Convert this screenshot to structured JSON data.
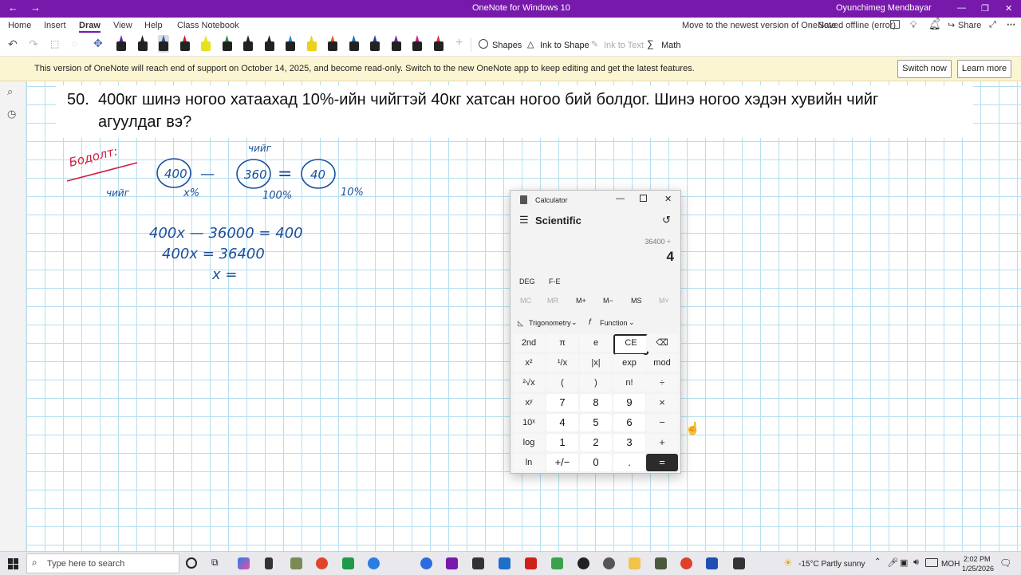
{
  "titlebar": {
    "back": "←",
    "forward": "→",
    "title": "OneNote for Windows 10",
    "user": "Oyunchimeg Mendbayar",
    "min": "—",
    "max": "❐",
    "close": "✕"
  },
  "menu": {
    "items": [
      "Home",
      "Insert",
      "Draw",
      "View",
      "Help",
      "Class Notebook"
    ],
    "move_newest": "Move to the newest version of OneNote",
    "saved": "Saved offline (error)",
    "notif_count": "5",
    "share": "Share"
  },
  "toolbar": {
    "shapes": "Shapes",
    "ink_to_shape": "Ink to Shape",
    "ink_to_text": "Ink to Text",
    "math": "Math",
    "pen_colors": [
      "#5b2aa8",
      "#222222",
      "#1f5ba6",
      "#c61f2c",
      "#e6e21b",
      "#2f8d4e",
      "#222222",
      "#222222",
      "#1e8fd6",
      "#e8d21b",
      "#e25c1b",
      "#1e6fb0",
      "#1a3fa0",
      "#6a2aa5",
      "#d01c7c",
      "#d63a3a"
    ]
  },
  "banner": {
    "text": "This version of OneNote will reach end of support on October 14, 2025, and become read-only. Switch to the new OneNote app to keep editing and get the latest features.",
    "switch_now": "Switch now",
    "learn_more": "Learn more"
  },
  "question": {
    "number": "50.",
    "line1": "400кг шинэ ногоо хатаахад 10%-ийн чийгтэй 40кг хатсан ногоо бий болдог. Шинэ ногоо хэдэн хувийн чийг",
    "line2": "агуулдаг вэ?"
  },
  "handwriting": {
    "label": "Бодолт:",
    "chiig_top": "чийг",
    "chiig_left": "чийг",
    "c1": "400",
    "minus": "—",
    "c2": "360",
    "eq": "=",
    "c3": "40",
    "p1": "x%",
    "p2": "100%",
    "p3": "10%",
    "eq1": "400x — 36000 = 400",
    "eq2": "400x = 36400",
    "eq3": "x ="
  },
  "calculator": {
    "title": "Calculator",
    "mode": "Scientific",
    "expression": "36400 ÷",
    "display": "4",
    "deg": "DEG",
    "fe": "F-E",
    "memory": [
      "MC",
      "MR",
      "M+",
      "M−",
      "MS",
      "M˅"
    ],
    "trig": "Trigonometry",
    "func": "Function",
    "keys": [
      [
        "2nd",
        "π",
        "e",
        "CE",
        "⌫"
      ],
      [
        "x²",
        "¹/x",
        "|x|",
        "exp",
        "mod"
      ],
      [
        "²√x",
        "(",
        ")",
        "n!",
        "÷"
      ],
      [
        "xʸ",
        "7",
        "8",
        "9",
        "×"
      ],
      [
        "10ˣ",
        "4",
        "5",
        "6",
        "−"
      ],
      [
        "log",
        "1",
        "2",
        "3",
        "+"
      ],
      [
        "ln",
        "+/−",
        "0",
        ".",
        "="
      ]
    ]
  },
  "taskbar": {
    "search_placeholder": "Type here to search",
    "weather": "-15°C  Partly sunny",
    "lang": "МОН",
    "time": "2:02 PM",
    "date": "1/25/2026"
  }
}
